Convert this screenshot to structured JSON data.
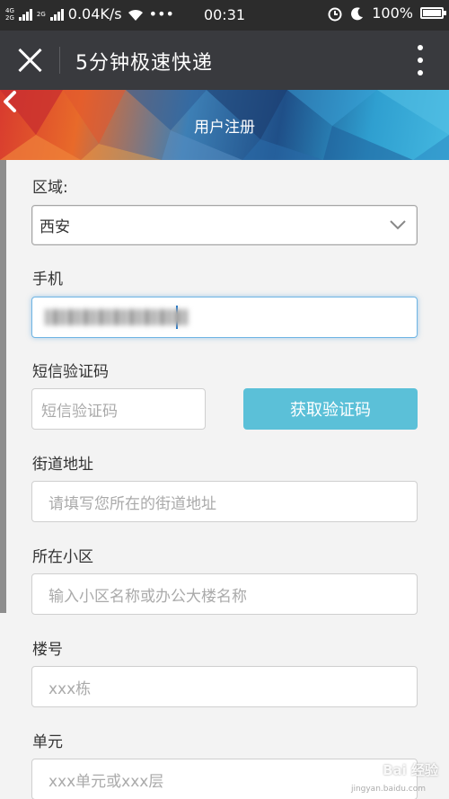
{
  "status_bar": {
    "network_top": "4G",
    "network_bottom": "2G",
    "network2": "2G",
    "speed": "0.04K/s",
    "dots": "•••",
    "time": "00:31",
    "battery": "100%"
  },
  "app_bar": {
    "title": "5分钟极速快递"
  },
  "header": {
    "title": "用户注册"
  },
  "form": {
    "region_label": "区域:",
    "region_value": "西安",
    "phone_label": "手机",
    "sms_label": "短信验证码",
    "sms_placeholder": "短信验证码",
    "sms_button": "获取验证码",
    "street_label": "街道地址",
    "street_placeholder": "请填写您所在的街道地址",
    "community_label": "所在小区",
    "community_placeholder": "输入小区名称或办公大楼名称",
    "building_label": "楼号",
    "building_placeholder": "xxx栋",
    "unit_label": "单元",
    "unit_placeholder": "xxx单元或xxx层"
  },
  "watermark": {
    "text": "Bai 经验",
    "url": "jingyan.baidu.com"
  }
}
